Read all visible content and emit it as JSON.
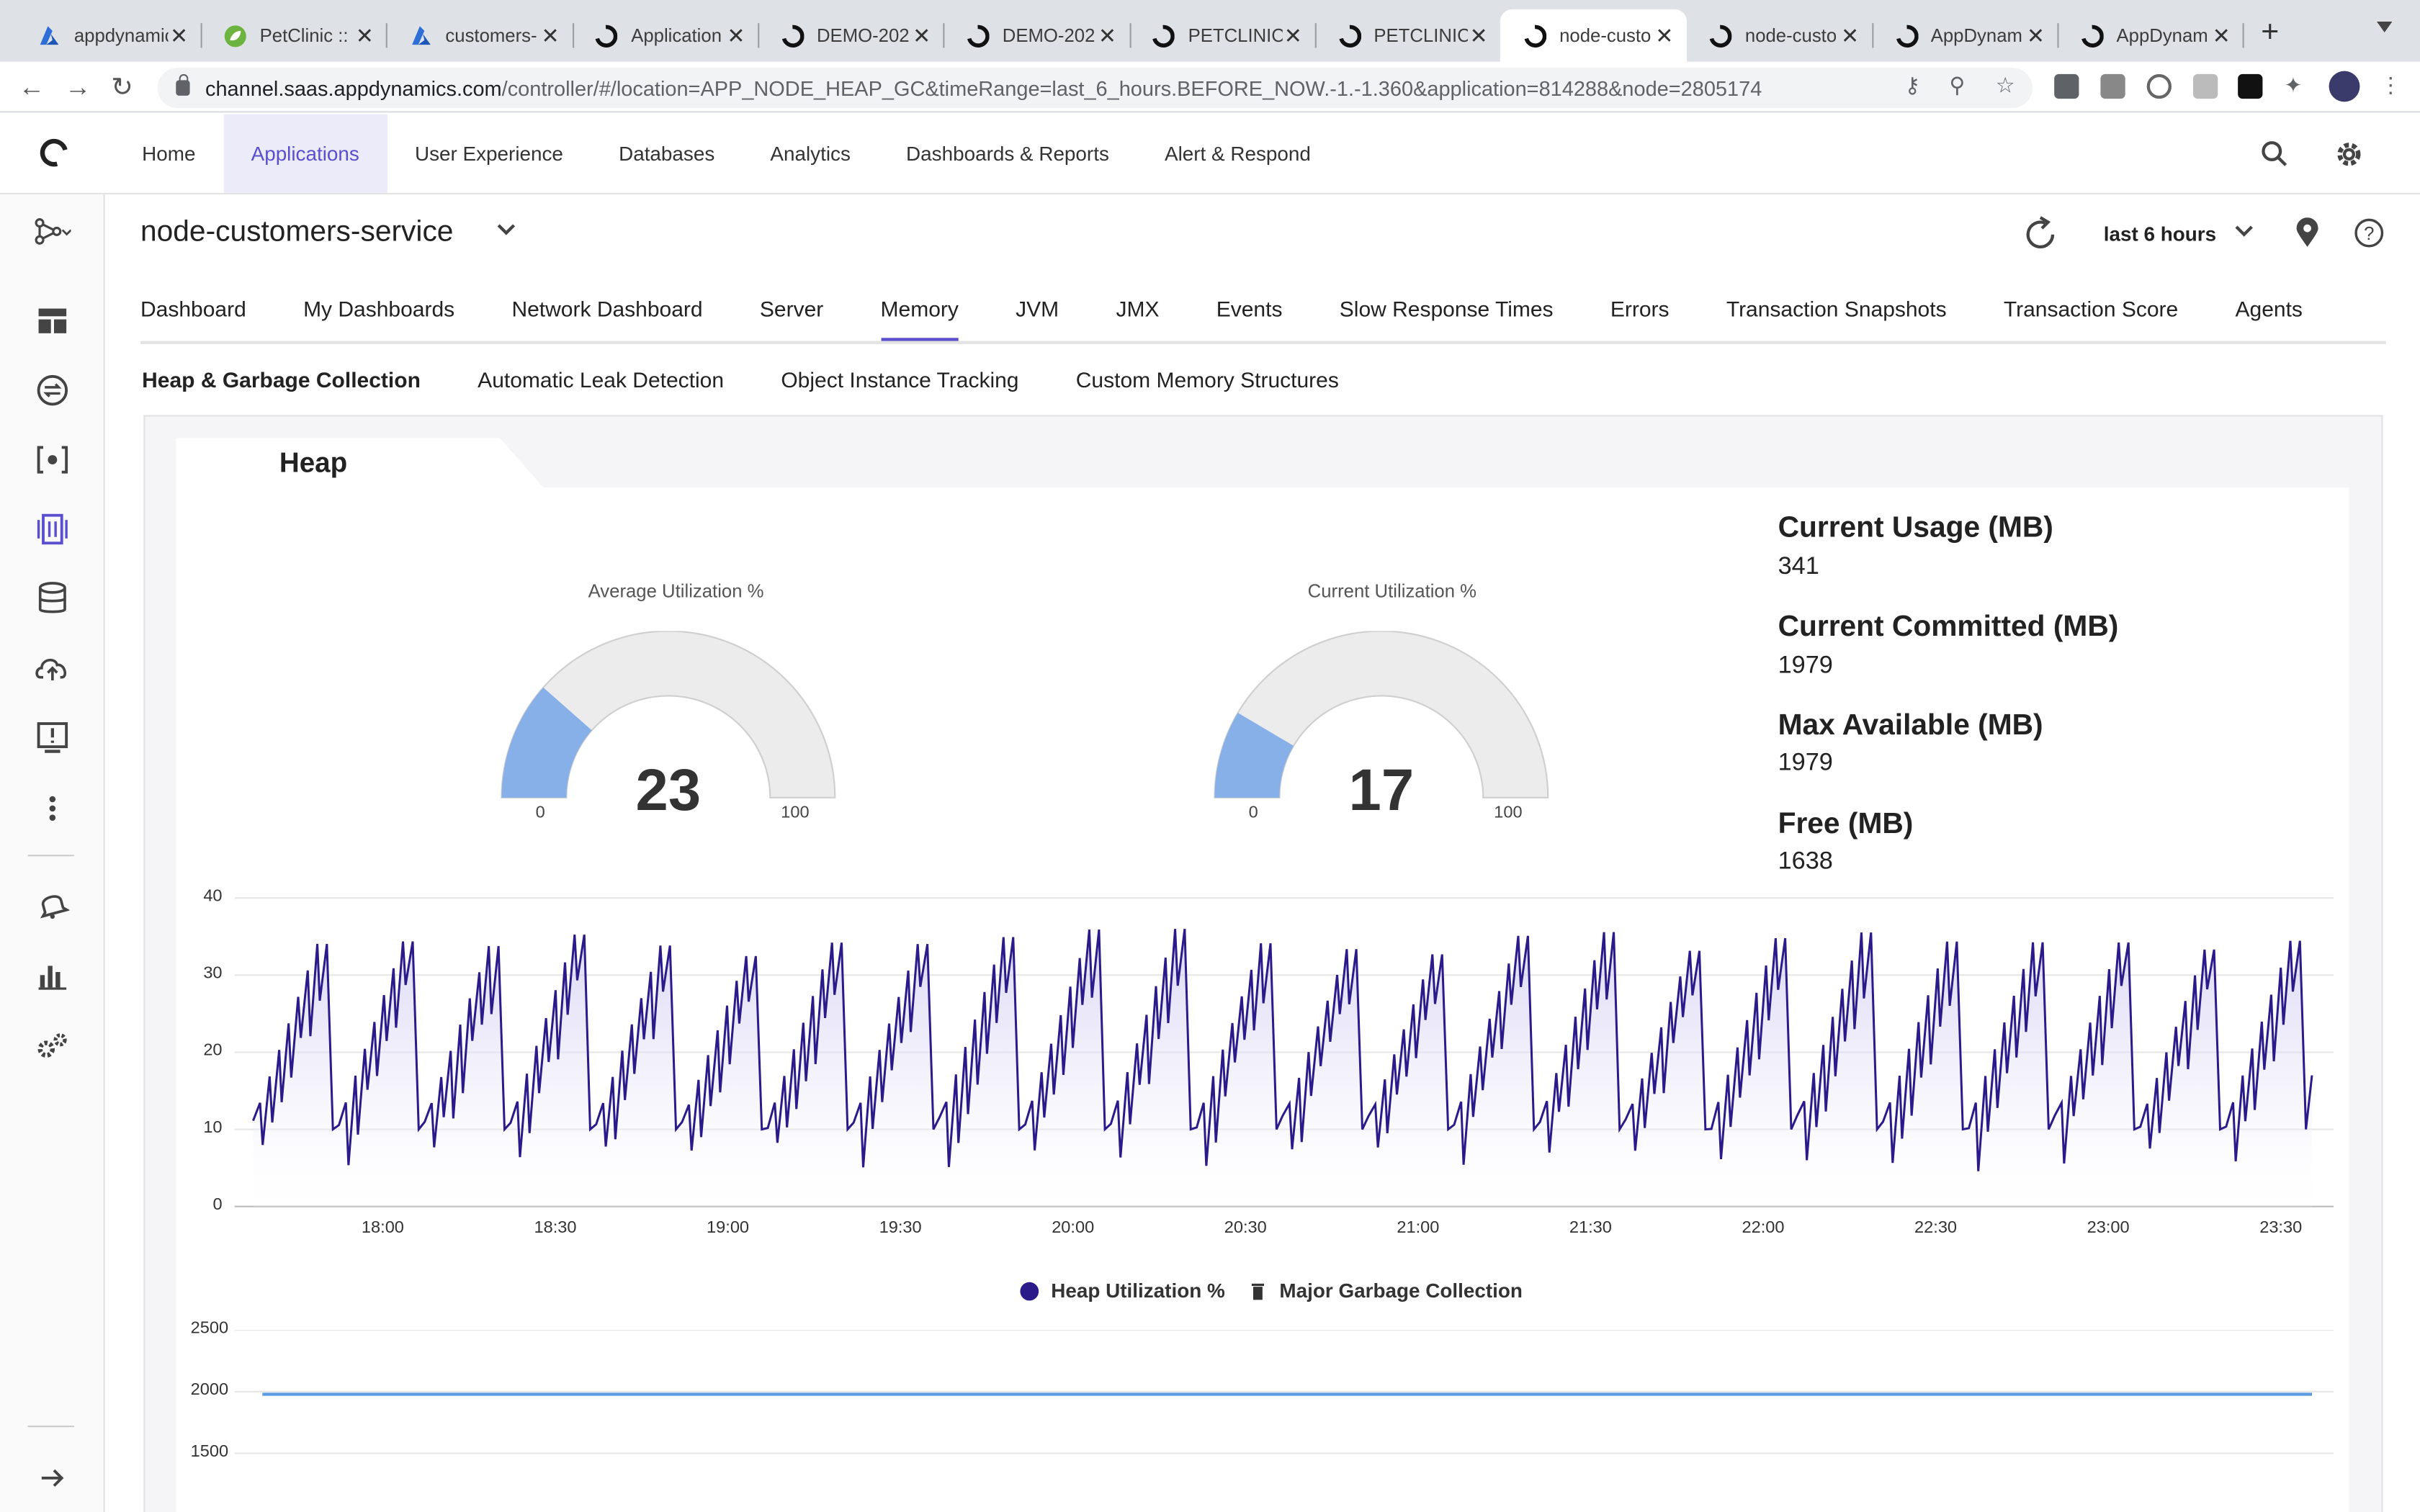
{
  "browser": {
    "tabs": [
      {
        "title": "appdynamic",
        "icon": "azure-icon"
      },
      {
        "title": "PetClinic ::",
        "icon": "spring-icon"
      },
      {
        "title": "customers-",
        "icon": "azure-icon"
      },
      {
        "title": "Application",
        "icon": "appd-icon"
      },
      {
        "title": "DEMO-202",
        "icon": "appd-icon"
      },
      {
        "title": "DEMO-202",
        "icon": "appd-icon"
      },
      {
        "title": "PETCLINIC",
        "icon": "appd-icon"
      },
      {
        "title": "PETCLINIC",
        "icon": "appd-icon"
      },
      {
        "title": "node-custo",
        "icon": "appd-icon",
        "active": true
      },
      {
        "title": "node-custo",
        "icon": "appd-icon"
      },
      {
        "title": "AppDynam",
        "icon": "appd-icon"
      },
      {
        "title": "AppDynam",
        "icon": "appd-icon"
      }
    ],
    "url_host": "channel.saas.appdynamics.com",
    "url_path": "/controller/#/location=APP_NODE_HEAP_GC&timeRange=last_6_hours.BEFORE_NOW.-1.-1.360&application=814288&node=2805174"
  },
  "topnav": {
    "items": [
      "Home",
      "Applications",
      "User Experience",
      "Databases",
      "Analytics",
      "Dashboards & Reports",
      "Alert & Respond"
    ],
    "active": "Applications"
  },
  "app": {
    "name": "node-customers-service",
    "time_range": "last 6 hours"
  },
  "tabs": [
    "Dashboard",
    "My Dashboards",
    "Network Dashboard",
    "Server",
    "Memory",
    "JVM",
    "JMX",
    "Events",
    "Slow Response Times",
    "Errors",
    "Transaction Snapshots",
    "Transaction Score",
    "Agents"
  ],
  "subtabs": [
    "Heap & Garbage Collection",
    "Automatic Leak Detection",
    "Object Instance Tracking",
    "Custom Memory Structures"
  ],
  "panel": {
    "title": "Heap",
    "avg_gauge": {
      "title": "Average Utilization %",
      "value": 23,
      "min": "0",
      "max": "100"
    },
    "cur_gauge": {
      "title": "Current Utilization %",
      "value": 17,
      "min": "0",
      "max": "100"
    },
    "stats": [
      {
        "label": "Current Usage (MB)",
        "value": "341"
      },
      {
        "label": "Current Committed (MB)",
        "value": "1979"
      },
      {
        "label": "Max Available (MB)",
        "value": "1979"
      },
      {
        "label": "Free (MB)",
        "value": "1638"
      }
    ]
  },
  "colors": {
    "accent": "#5a4fcf",
    "gauge_fill": "#87b0e8",
    "series_line": "#2a1a8a",
    "committed_line": "#5b9be0"
  },
  "chart_data": [
    {
      "type": "area",
      "ylim": [
        0,
        40
      ],
      "yticks": [
        "40",
        "30",
        "20",
        "10",
        "0"
      ],
      "xticks": [
        "18:00",
        "18:30",
        "19:00",
        "19:30",
        "20:00",
        "20:30",
        "21:00",
        "21:30",
        "22:00",
        "22:30",
        "23:00",
        "23:30"
      ],
      "series": [
        {
          "name": "Heap Utilization %",
          "pattern": "sawtooth",
          "min": 10,
          "max": 36
        }
      ],
      "legend": [
        "Heap Utilization %",
        "Major Garbage Collection"
      ]
    },
    {
      "type": "line",
      "ylim": [
        1500,
        2500
      ],
      "yticks": [
        "2500",
        "2000",
        "1500"
      ],
      "series": [
        {
          "value": 1979
        }
      ]
    }
  ]
}
